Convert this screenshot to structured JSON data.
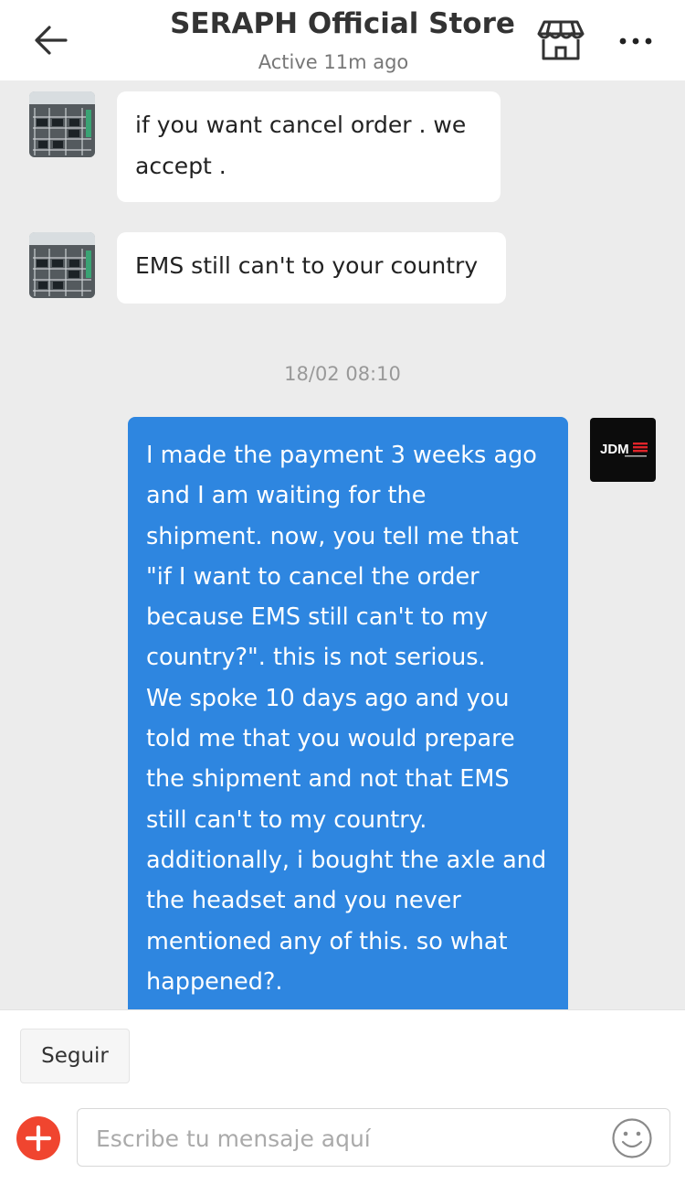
{
  "header": {
    "title": "SERAPH Official Store",
    "status": "Active 11m ago"
  },
  "chat": {
    "incoming": [
      {
        "lines": [
          "if you want cancel order . we",
          "accept ."
        ]
      },
      {
        "lines": [
          "EMS still can't to your country"
        ]
      }
    ],
    "timestamp": "18/02 08:10",
    "my_avatar_text": "JDM",
    "outgoing": {
      "lines": [
        "I made the payment 3 weeks ago",
        "and I am waiting for the",
        "shipment. now, you tell me that",
        "\"if I want to cancel the order",
        "because EMS still can't to my",
        "country?\". this is not serious.",
        "We spoke 10 days ago and you",
        "told me that you would prepare",
        "the shipment and not that EMS",
        "still can't to my country.",
        "additionally, i bought the axle and",
        "the headset and you never",
        "mentioned any of this. so what",
        "happened?."
      ]
    }
  },
  "footer": {
    "follow_label": "Seguir",
    "input_placeholder": "Escribe tu mensaje aquí"
  },
  "colors": {
    "outgoing_bubble": "#2e86e0",
    "plus_button": "#f0452f"
  }
}
